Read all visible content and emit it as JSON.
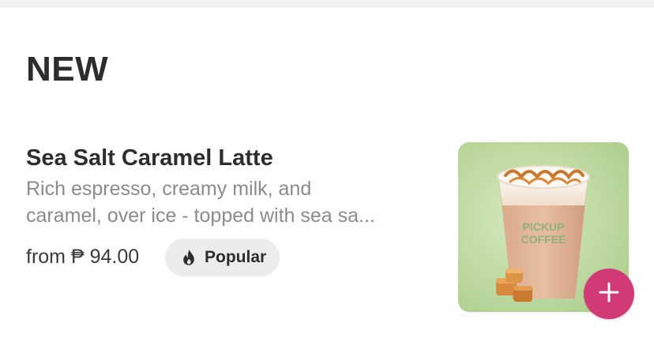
{
  "section": {
    "title": "NEW"
  },
  "product": {
    "name": "Sea Salt Caramel Latte",
    "description_lines": [
      "Rich espresso, creamy milk, and",
      "caramel, over ice - topped with sea sa..."
    ],
    "price": "from ₱ 94.00",
    "badge": {
      "icon": "fire-icon",
      "label": "Popular"
    },
    "image": {
      "cup_print_line1": "PICKUP",
      "cup_print_line2": "COFFEE"
    },
    "add_button_icon": "plus-icon"
  },
  "colors": {
    "accent": "#d13a77",
    "badge_bg": "#ececee",
    "thumb_bg": "#c4dca8"
  }
}
